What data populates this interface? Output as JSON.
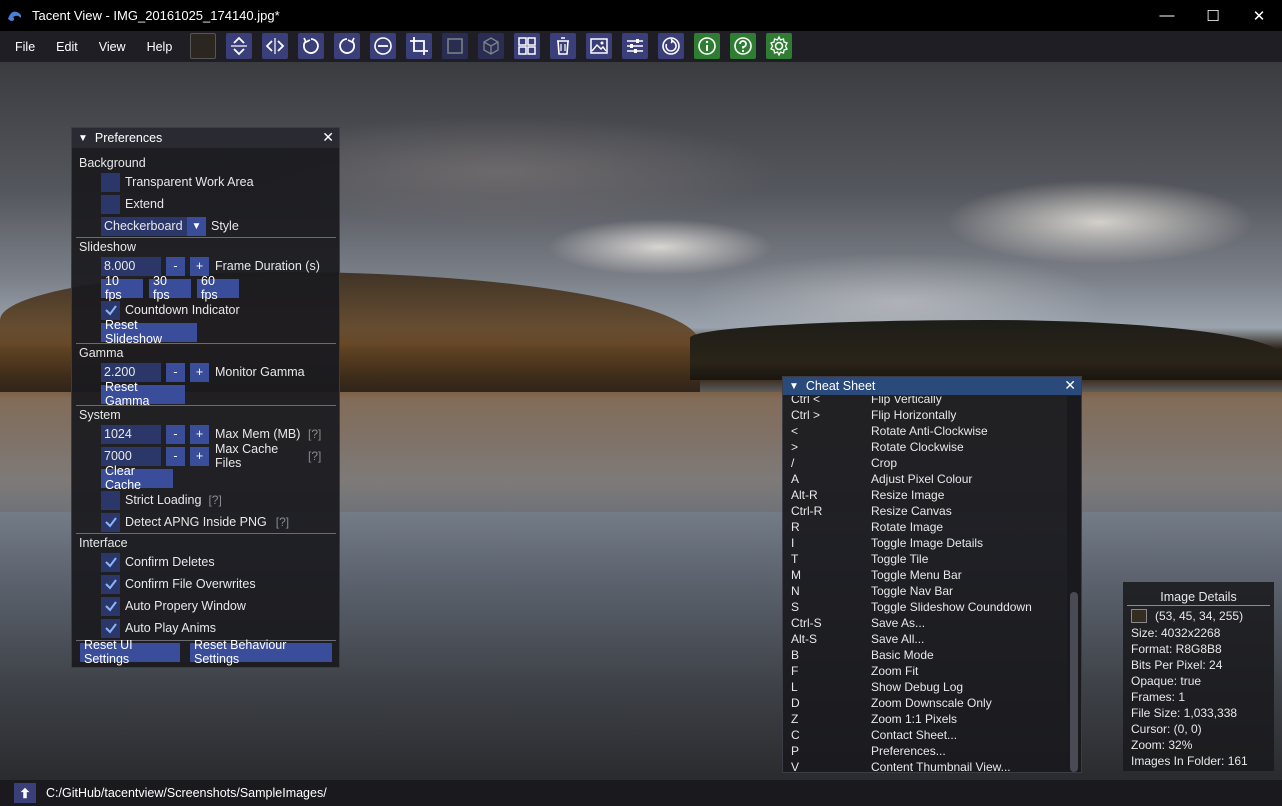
{
  "window": {
    "title": "Tacent View - IMG_20161025_174140.jpg*",
    "minimize": "—",
    "maximize": "☐",
    "close": "✕"
  },
  "menu": {
    "items": [
      "File",
      "Edit",
      "View",
      "Help"
    ]
  },
  "toolbar": {
    "icons": [
      "color-swatch-icon",
      "flip-vertical-icon",
      "flip-horizontal-icon",
      "rotate-anticlockwise-icon",
      "rotate-clockwise-icon",
      "minus-icon",
      "crop-icon",
      "resize-canvas-icon",
      "cube-icon",
      "tile-icon",
      "delete-icon",
      "image-icon",
      "preferences-icon",
      "slideshow-icon",
      "info-icon",
      "help-icon",
      "settings-icon"
    ],
    "swatch_color": "#2c2620",
    "green_color": "#2e7d32"
  },
  "prefs": {
    "title": "Preferences",
    "close": "✕",
    "background": {
      "header": "Background",
      "transparent": {
        "label": "Transparent Work Area",
        "checked": false
      },
      "extend": {
        "label": "Extend",
        "checked": false
      },
      "style_value": "Checkerboard",
      "style_label": "Style"
    },
    "slideshow": {
      "header": "Slideshow",
      "frame_value": "8.000",
      "minus": "-",
      "plus": "+",
      "frame_label": "Frame Duration (s)",
      "fps10": "10 fps",
      "fps30": "30 fps",
      "fps60": "60 fps",
      "countdown": {
        "label": "Countdown Indicator",
        "checked": true
      },
      "reset": "Reset Slideshow"
    },
    "gamma": {
      "header": "Gamma",
      "value": "2.200",
      "minus": "-",
      "plus": "+",
      "label": "Monitor Gamma",
      "reset": "Reset Gamma"
    },
    "system": {
      "header": "System",
      "maxmem_value": "1024",
      "maxmem_label": "Max Mem (MB)",
      "maxcache_value": "7000",
      "maxcache_label": "Max Cache Files",
      "minus": "-",
      "plus": "+",
      "help": "[?]",
      "clear_cache": "Clear Cache",
      "strict": {
        "label": "Strict Loading",
        "checked": false
      },
      "apng": {
        "label": "Detect APNG Inside PNG",
        "checked": true
      }
    },
    "interface": {
      "header": "Interface",
      "confirm_deletes": {
        "label": "Confirm Deletes",
        "checked": true
      },
      "confirm_overwrites": {
        "label": "Confirm File Overwrites",
        "checked": true
      },
      "auto_property": {
        "label": "Auto Propery Window",
        "checked": true
      },
      "auto_play": {
        "label": "Auto Play Anims",
        "checked": true
      }
    },
    "reset_ui": "Reset UI Settings",
    "reset_behaviour": "Reset Behaviour Settings"
  },
  "cheat": {
    "title": "Cheat Sheet",
    "close": "✕",
    "rows": [
      {
        "key": "Ctrl <",
        "desc": "Flip Vertically"
      },
      {
        "key": "Ctrl >",
        "desc": "Flip Horizontally"
      },
      {
        "key": "<",
        "desc": "Rotate Anti-Clockwise"
      },
      {
        "key": ">",
        "desc": "Rotate Clockwise"
      },
      {
        "key": "/",
        "desc": "Crop"
      },
      {
        "key": "A",
        "desc": "Adjust Pixel Colour"
      },
      {
        "key": "Alt-R",
        "desc": "Resize Image"
      },
      {
        "key": "Ctrl-R",
        "desc": "Resize Canvas"
      },
      {
        "key": "R",
        "desc": "Rotate Image"
      },
      {
        "key": "I",
        "desc": "Toggle Image Details"
      },
      {
        "key": "T",
        "desc": "Toggle Tile"
      },
      {
        "key": "M",
        "desc": "Toggle Menu Bar"
      },
      {
        "key": "N",
        "desc": "Toggle Nav Bar"
      },
      {
        "key": "S",
        "desc": "Toggle Slideshow Counddown"
      },
      {
        "key": "Ctrl-S",
        "desc": "Save As..."
      },
      {
        "key": "Alt-S",
        "desc": "Save All..."
      },
      {
        "key": "B",
        "desc": "Basic Mode"
      },
      {
        "key": "F",
        "desc": "Zoom Fit"
      },
      {
        "key": "L",
        "desc": "Show Debug Log"
      },
      {
        "key": "D",
        "desc": "Zoom Downscale Only"
      },
      {
        "key": "Z",
        "desc": "Zoom 1:1 Pixels"
      },
      {
        "key": "C",
        "desc": "Contact Sheet..."
      },
      {
        "key": "P",
        "desc": "Preferences..."
      },
      {
        "key": "V",
        "desc": "Content Thumbnail View..."
      }
    ]
  },
  "details": {
    "header": "Image   Details",
    "swatch_color": "#352d22",
    "pixel": "(53, 45, 34, 255)",
    "size": "Size: 4032x2268",
    "format": "Format: R8G8B8",
    "bpp": "Bits Per Pixel: 24",
    "opaque": "Opaque: true",
    "frames": "Frames: 1",
    "filesize": "File Size: 1,033,338",
    "cursor": "Cursor: (0, 0)",
    "zoom": "Zoom: 32%",
    "folder": "Images In Folder: 161"
  },
  "status": {
    "path": "C:/GitHub/tacentview/Screenshots/SampleImages/"
  }
}
